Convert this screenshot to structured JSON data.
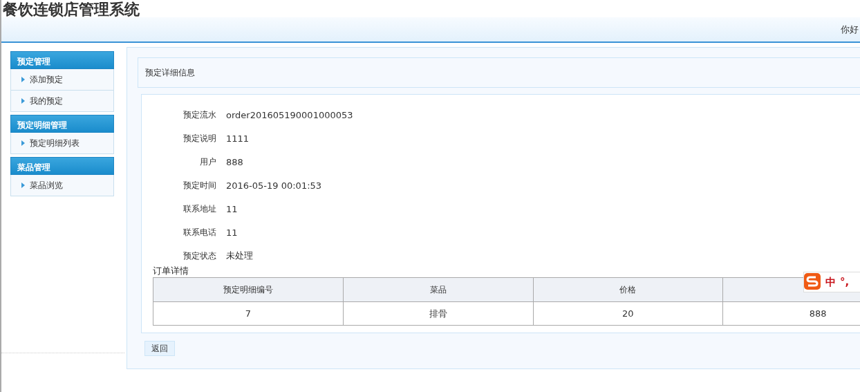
{
  "app_title": "餐饮连锁店管理系统",
  "greeting": "你好",
  "sidebar": [
    {
      "title": "预定管理",
      "items": [
        {
          "label": "添加预定"
        },
        {
          "label": "我的预定"
        }
      ]
    },
    {
      "title": "预定明细管理",
      "items": [
        {
          "label": "预定明细列表"
        }
      ]
    },
    {
      "title": "菜品管理",
      "items": [
        {
          "label": "菜品浏览"
        }
      ]
    }
  ],
  "panel_title": "预定详细信息",
  "fields": [
    {
      "label": "预定流水",
      "value": "order201605190001000053"
    },
    {
      "label": "预定说明",
      "value": "1111"
    },
    {
      "label": "用户",
      "value": "888"
    },
    {
      "label": "预定时间",
      "value": "2016-05-19 00:01:53"
    },
    {
      "label": "联系地址",
      "value": "11"
    },
    {
      "label": "联系电话",
      "value": "11"
    },
    {
      "label": "预定状态",
      "value": "未处理"
    }
  ],
  "table_caption": "订单详情",
  "table": {
    "columns": [
      "预定明细编号",
      "菜品",
      "价格",
      ""
    ],
    "rows": [
      [
        "7",
        "排骨",
        "20",
        "888"
      ]
    ]
  },
  "back_button": "返回",
  "ime_toolbar": {
    "mode": "中",
    "punctuation": "°,"
  }
}
